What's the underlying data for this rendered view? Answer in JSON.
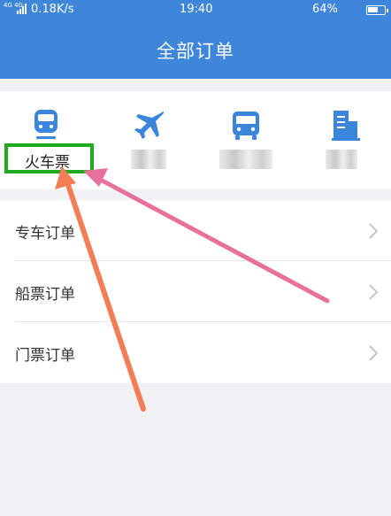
{
  "status_bar": {
    "network": "4G 4G",
    "speed": "0.18K/s",
    "time": "19:40",
    "battery_percent": "64%",
    "battery_level": 0.64
  },
  "header": {
    "title": "全部订单"
  },
  "categories": [
    {
      "label": "火车票",
      "icon": "train-icon"
    },
    {
      "label": "",
      "icon": "airplane-icon"
    },
    {
      "label": "",
      "icon": "bus-icon"
    },
    {
      "label": "",
      "icon": "hotel-building-icon"
    }
  ],
  "orders": [
    {
      "label": "专车订单",
      "icon": "chevron-right-icon"
    },
    {
      "label": "船票订单",
      "icon": "chevron-right-icon"
    },
    {
      "label": "门票订单",
      "icon": "chevron-right-icon"
    }
  ],
  "colors": {
    "header": "#3d86d9",
    "icon": "#3b86db",
    "highlight": "#1faa1f",
    "arrow_pink": "#e8719c",
    "arrow_orange": "#f47d55"
  }
}
